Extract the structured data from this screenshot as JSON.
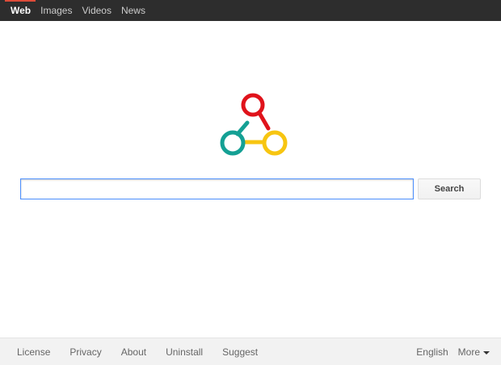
{
  "nav": {
    "items": [
      {
        "label": "Web",
        "active": true
      },
      {
        "label": "Images",
        "active": false
      },
      {
        "label": "Videos",
        "active": false
      },
      {
        "label": "News",
        "active": false
      }
    ]
  },
  "logo": {
    "icon": "network-triangle-logo",
    "colors": {
      "top": "#e0131b",
      "left": "#14a094",
      "right": "#f7c511"
    }
  },
  "search": {
    "value": "",
    "placeholder": "",
    "button_label": "Search"
  },
  "footer": {
    "left_links": [
      "License",
      "Privacy",
      "About",
      "Uninstall",
      "Suggest"
    ],
    "language": "English",
    "more_label": "More"
  },
  "colors": {
    "topbar": "#2d2d2d",
    "focus_border": "#4d90fe"
  }
}
